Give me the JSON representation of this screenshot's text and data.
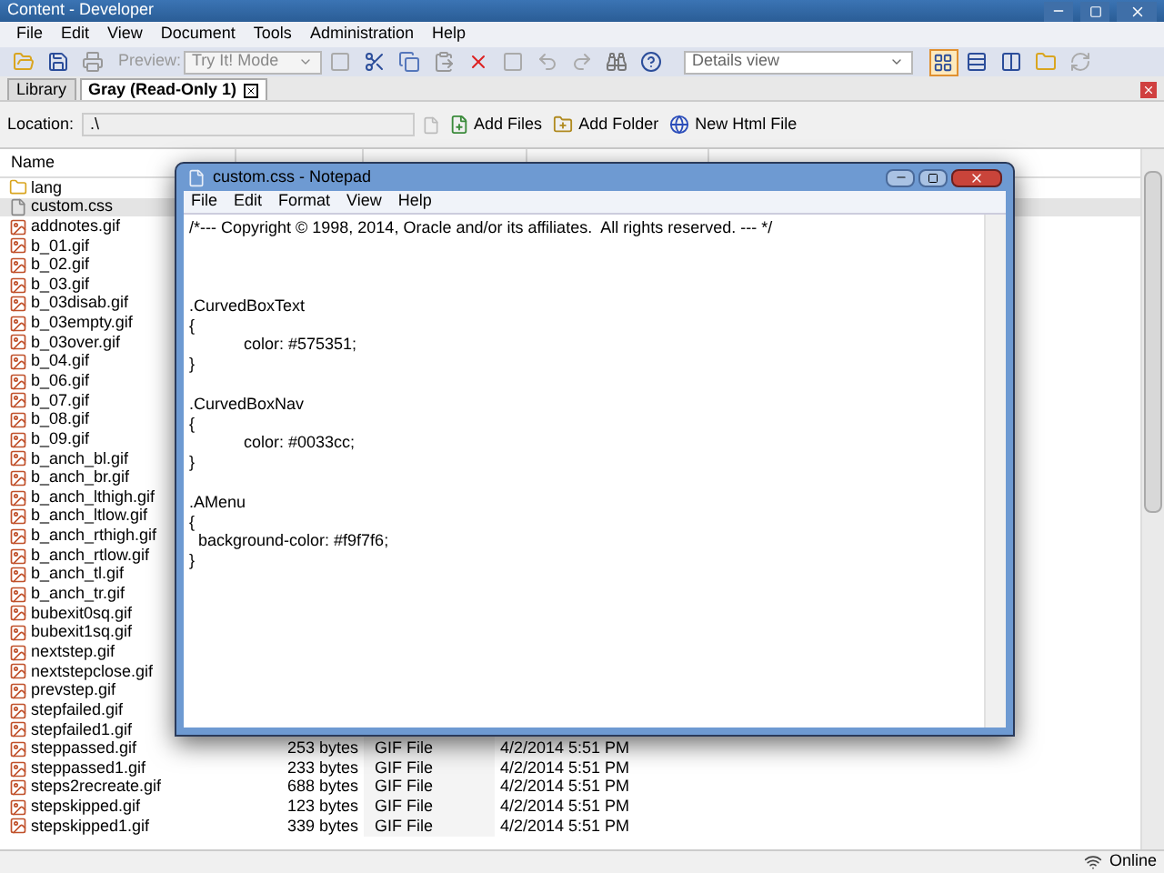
{
  "window": {
    "title": "Content - Developer"
  },
  "menu": [
    "File",
    "Edit",
    "View",
    "Document",
    "Tools",
    "Administration",
    "Help"
  ],
  "toolbar": {
    "preview_label": "Preview:",
    "mode": "Try It! Mode",
    "view": "Details view"
  },
  "tabs": [
    {
      "label": "Library",
      "selected": false,
      "closable": false
    },
    {
      "label": "Gray (Read-Only 1)",
      "selected": true,
      "closable": true
    }
  ],
  "location": {
    "label": "Location:",
    "value": ".\\",
    "actions": [
      "Add Files",
      "Add Folder",
      "New Html File"
    ]
  },
  "table": {
    "columns": [
      "Name"
    ],
    "rows": [
      {
        "name": "lang",
        "kind": "folder",
        "selected": false
      },
      {
        "name": "custom.css",
        "kind": "file",
        "selected": true
      },
      {
        "name": "addnotes.gif",
        "kind": "image",
        "selected": false
      },
      {
        "name": "b_01.gif",
        "kind": "image",
        "selected": false
      },
      {
        "name": "b_02.gif",
        "kind": "image",
        "selected": false
      },
      {
        "name": "b_03.gif",
        "kind": "image",
        "selected": false
      },
      {
        "name": "b_03disab.gif",
        "kind": "image",
        "selected": false
      },
      {
        "name": "b_03empty.gif",
        "kind": "image",
        "selected": false
      },
      {
        "name": "b_03over.gif",
        "kind": "image",
        "selected": false
      },
      {
        "name": "b_04.gif",
        "kind": "image",
        "selected": false
      },
      {
        "name": "b_06.gif",
        "kind": "image",
        "selected": false
      },
      {
        "name": "b_07.gif",
        "kind": "image",
        "selected": false
      },
      {
        "name": "b_08.gif",
        "kind": "image",
        "selected": false
      },
      {
        "name": "b_09.gif",
        "kind": "image",
        "selected": false
      },
      {
        "name": "b_anch_bl.gif",
        "kind": "image",
        "selected": false
      },
      {
        "name": "b_anch_br.gif",
        "kind": "image",
        "selected": false
      },
      {
        "name": "b_anch_lthigh.gif",
        "kind": "image",
        "selected": false
      },
      {
        "name": "b_anch_ltlow.gif",
        "kind": "image",
        "selected": false
      },
      {
        "name": "b_anch_rthigh.gif",
        "kind": "image",
        "selected": false
      },
      {
        "name": "b_anch_rtlow.gif",
        "kind": "image",
        "selected": false
      },
      {
        "name": "b_anch_tl.gif",
        "kind": "image",
        "selected": false
      },
      {
        "name": "b_anch_tr.gif",
        "kind": "image",
        "selected": false
      },
      {
        "name": "bubexit0sq.gif",
        "kind": "image",
        "selected": false
      },
      {
        "name": "bubexit1sq.gif",
        "kind": "image",
        "selected": false
      },
      {
        "name": "nextstep.gif",
        "kind": "image",
        "selected": false
      },
      {
        "name": "nextstepclose.gif",
        "kind": "image",
        "selected": false
      },
      {
        "name": "prevstep.gif",
        "kind": "image",
        "selected": false
      },
      {
        "name": "stepfailed.gif",
        "kind": "image",
        "selected": false
      },
      {
        "name": "stepfailed1.gif",
        "kind": "image",
        "selected": false
      },
      {
        "name": "steppassed.gif",
        "kind": "image",
        "selected": false,
        "size": "253 bytes",
        "type": "GIF File",
        "date": "4/2/2014 5:51 PM"
      },
      {
        "name": "steppassed1.gif",
        "kind": "image",
        "selected": false,
        "size": "233 bytes",
        "type": "GIF File",
        "date": "4/2/2014 5:51 PM"
      },
      {
        "name": "steps2recreate.gif",
        "kind": "image",
        "selected": false,
        "size": "688 bytes",
        "type": "GIF File",
        "date": "4/2/2014 5:51 PM"
      },
      {
        "name": "stepskipped.gif",
        "kind": "image",
        "selected": false,
        "size": "123 bytes",
        "type": "GIF File",
        "date": "4/2/2014 5:51 PM"
      },
      {
        "name": "stepskipped1.gif",
        "kind": "image",
        "selected": false,
        "size": "339 bytes",
        "type": "GIF File",
        "date": "4/2/2014 5:51 PM"
      }
    ]
  },
  "notepad": {
    "title": "custom.css - Notepad",
    "menu": [
      "File",
      "Edit",
      "Format",
      "View",
      "Help"
    ],
    "blocks": [
      [
        "/*--- Copyright © 1998, 2014, Oracle and/or its affiliates.  All rights reserved. --- */"
      ],
      [
        ".CurvedBoxText",
        "{",
        "            color: #575351;",
        "}"
      ],
      [
        ".CurvedBoxNav",
        "{",
        "            color: #0033cc;",
        "}"
      ],
      [
        ".AMenu",
        "{",
        "  background-color: #f9f7f6;",
        "}"
      ]
    ]
  },
  "status_bar": {
    "status": "Online"
  }
}
